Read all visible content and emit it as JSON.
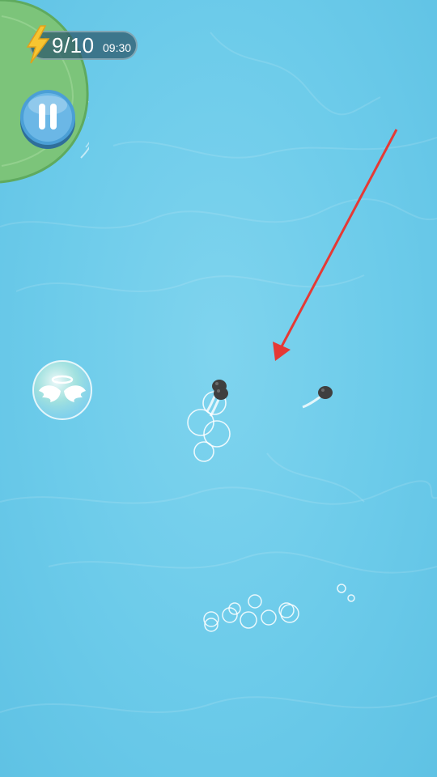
{
  "hud": {
    "energy_count": "9/10",
    "energy_timer": "09:30"
  },
  "icons": {
    "energy": "lightning-bolt-icon",
    "pause": "pause-icon",
    "powerup": "angel-wings-halo-icon"
  },
  "colors": {
    "water": "#6ccbea",
    "lilypad": "#7cc47a",
    "hud_bg": "#2e5a6c",
    "bolt": "#f7c531",
    "pause_button": "#4b9fd6",
    "arrow": "#e53935",
    "tadpole": "#3f3f3f"
  }
}
